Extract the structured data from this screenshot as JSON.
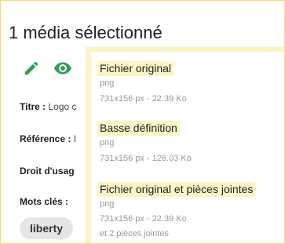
{
  "header": {
    "title": "1 média sélectionné"
  },
  "toolbar": {
    "edit_icon": "pencil-icon",
    "view_icon": "eye-icon",
    "accent_color": "#2e9e5b"
  },
  "fields": {
    "titre_label": "Titre :",
    "titre_value": "Logo c",
    "reference_label": "Référence :",
    "reference_value": "I",
    "droit_label": "Droit d'usag",
    "mots_cles_label": "Mots clés :"
  },
  "tags": [
    "liberty"
  ],
  "download_menu": {
    "options": [
      {
        "name": "Fichier original",
        "format": "png",
        "details": "731x156 px - 22.39 Ko"
      },
      {
        "name": "Basse définition",
        "format": "png",
        "details": "731x156 px - 126.03 Ko"
      },
      {
        "name": "Fichier original et pièces jointes",
        "format": "png",
        "details": "731x156 px - 22.39 Ko",
        "extra": "et 2 pièces jointes"
      }
    ],
    "highlight_color": "#fbf4c4"
  }
}
